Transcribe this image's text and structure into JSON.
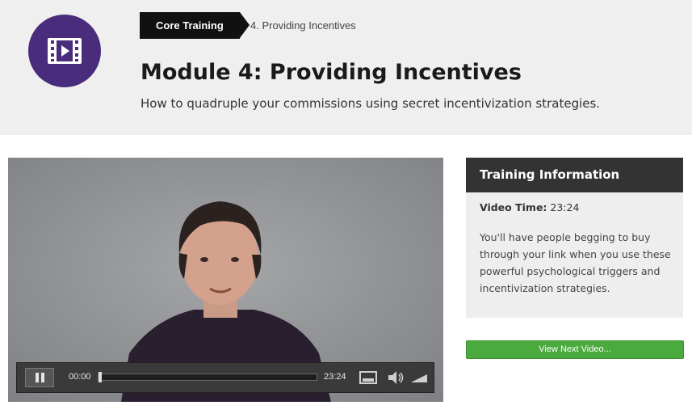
{
  "header": {
    "icon": "video-icon",
    "breadcrumb": {
      "section": "Core Training",
      "current": "4. Providing Incentives"
    },
    "title": "Module 4: Providing Incentives",
    "subtitle": "How to quadruple your commissions using secret incentivization strategies."
  },
  "player": {
    "current_time": "00:00",
    "total_time": "23:24",
    "progress": 0,
    "icons": [
      "pause-icon",
      "fullscreen-icon",
      "volume-icon",
      "volume-level-icon"
    ]
  },
  "sidebar": {
    "heading": "Training Information",
    "video_time_label": "Video Time:",
    "video_time_value": "23:24",
    "description": "You'll have people begging to buy through your link when you use these powerful psychological triggers and incentivization strategies."
  },
  "next_button": {
    "label": "View Next Video..."
  },
  "colors": {
    "icon_circle": "#4a2c7d",
    "header_bg": "#efefef",
    "badge_bg": "#111111",
    "panel_header_bg": "#333333",
    "panel_bg": "#eeeeee",
    "button_green": "#4aaa3e"
  }
}
